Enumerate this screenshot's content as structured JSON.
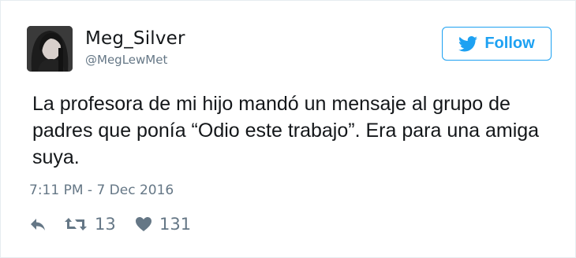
{
  "user": {
    "display_name": "Meg_Silver",
    "handle": "@MegLewMet",
    "avatar_icon": "profile-photo"
  },
  "follow": {
    "label": "Follow",
    "icon": "twitter-bird-icon",
    "color": "#1da1f2"
  },
  "tweet": {
    "text": "La profesora de mi hijo mandó un mensaje al grupo de padres que ponía “Odio este trabajo”. Era para una amiga suya.",
    "timestamp": "7:11 PM - 7 Dec 2016"
  },
  "actions": {
    "reply_icon": "reply-icon",
    "retweet_icon": "retweet-icon",
    "retweet_count": "13",
    "like_icon": "heart-icon",
    "like_count": "131"
  },
  "colors": {
    "text": "#14171a",
    "secondary": "#657786",
    "accent": "#1da1f2"
  }
}
